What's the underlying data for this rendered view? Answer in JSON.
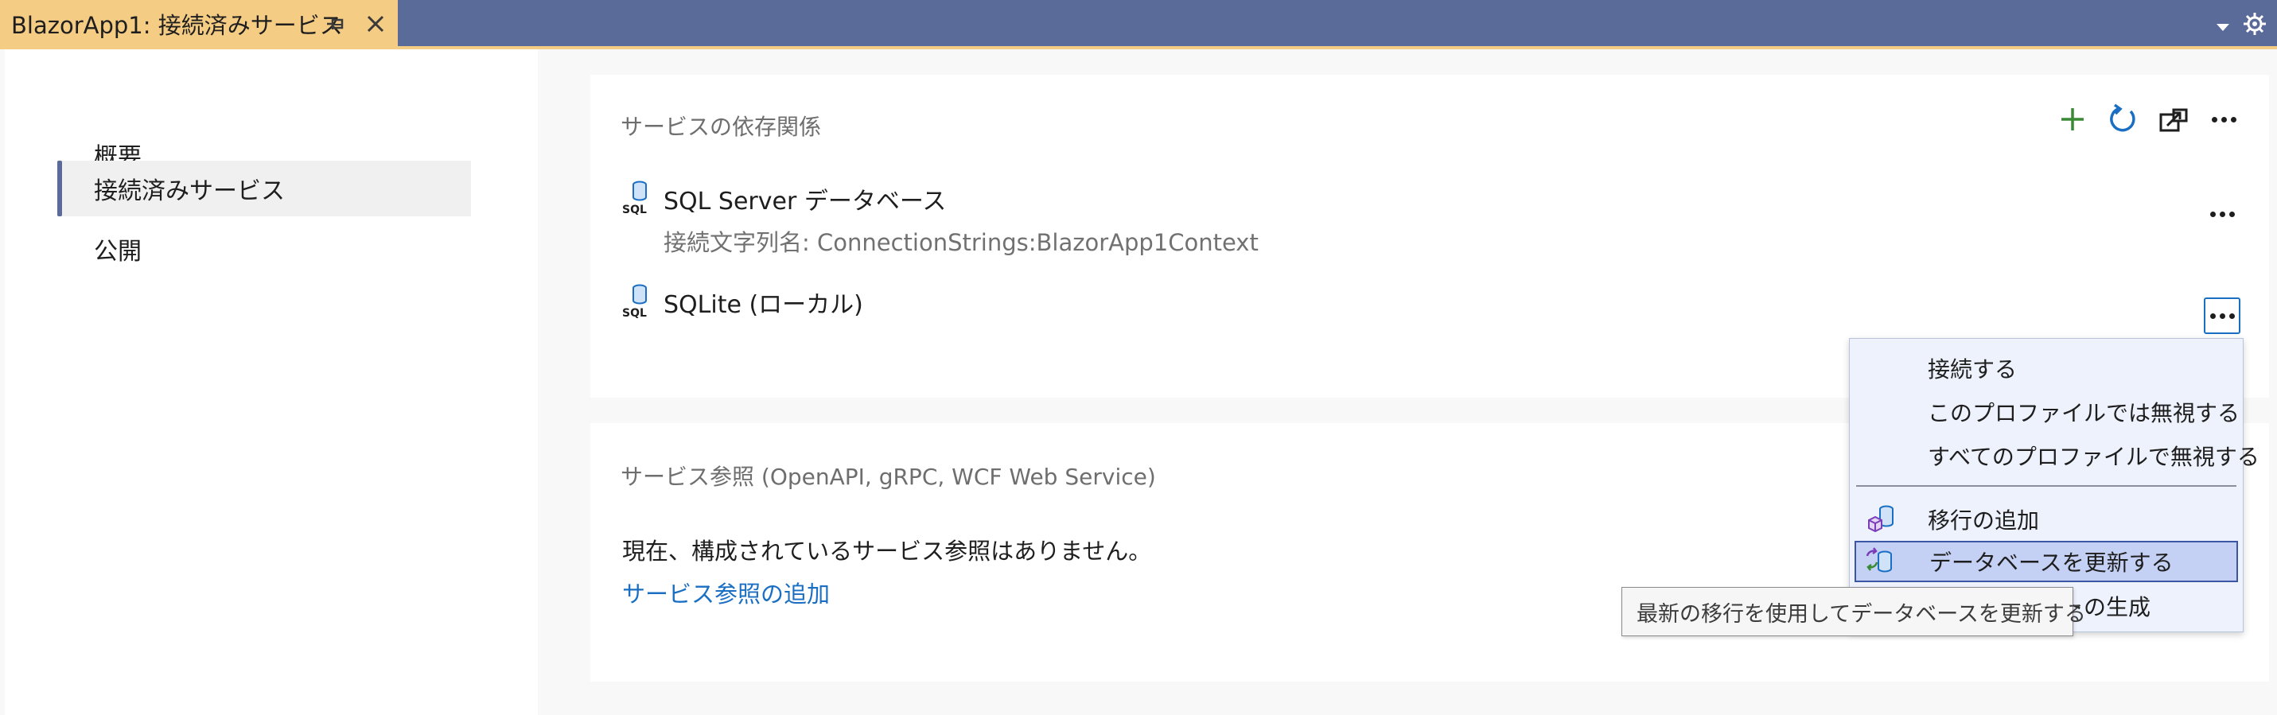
{
  "window": {
    "tab_title": "BlazorApp1: 接続済みサービス",
    "pin_icon": "pin-icon",
    "close_icon": "close-icon",
    "accent_color": "#f5cc84",
    "titlebar_color": "#5b6b99"
  },
  "sidebar": {
    "items": [
      {
        "label": "概要",
        "active": false
      },
      {
        "label": "接続済みサービス",
        "active": true
      },
      {
        "label": "公開",
        "active": false
      }
    ]
  },
  "dependencies": {
    "title": "サービスの依存関係",
    "toolbar": [
      "add-icon",
      "refresh-icon",
      "export-icon",
      "more-icon"
    ],
    "services": [
      {
        "name": "SQL Server データベース",
        "detail": "接続文字列名: ConnectionStrings:BlazorApp1Context",
        "icon": "sql-database-icon"
      },
      {
        "name": "SQLite (ローカル)",
        "detail": "",
        "icon": "sql-database-icon"
      }
    ]
  },
  "references": {
    "title": "サービス参照 (OpenAPI, gRPC, WCF Web Service)",
    "empty_message": "現在、構成されているサービス参照はありません。",
    "add_link": "サービス参照の追加"
  },
  "context_menu": {
    "items": [
      {
        "label": "接続する",
        "icon": ""
      },
      {
        "label": "このプロファイルでは無視する",
        "icon": ""
      },
      {
        "label": "すべてのプロファイルで無視する",
        "icon": ""
      },
      {
        "label": "移行の追加",
        "icon": "add-migration-icon"
      },
      {
        "label": "データベースを更新する",
        "icon": "update-database-icon",
        "selected": true
      },
      {
        "label": "移行スクリプトの生成",
        "icon": ""
      }
    ]
  },
  "tooltip": {
    "text": "最新の移行を使用してデータベースを更新する"
  }
}
